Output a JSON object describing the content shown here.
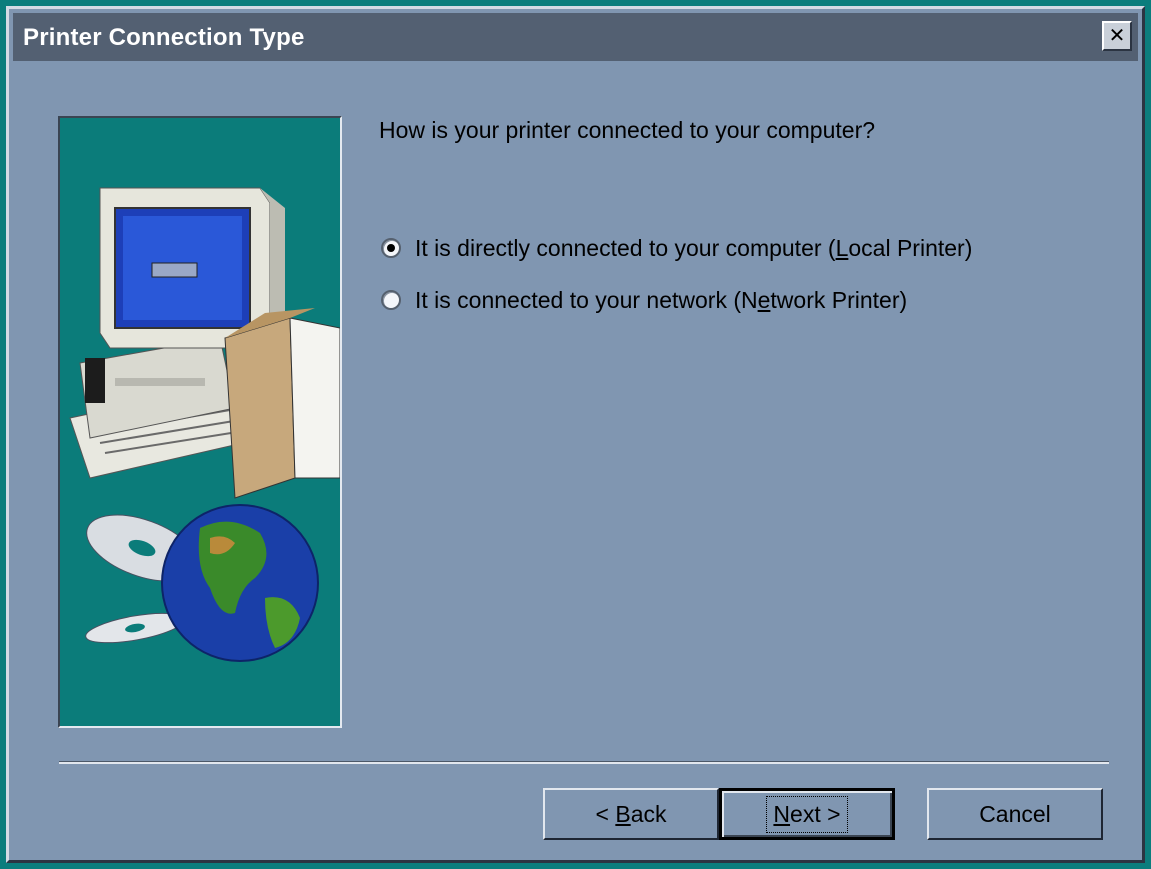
{
  "window": {
    "title": "Printer Connection Type",
    "close_label": "✕"
  },
  "question": "How is your printer connected to your computer?",
  "options": [
    {
      "pre": "It is directly connected to your computer (",
      "mnemonic": "L",
      "post": "ocal Printer)",
      "selected": true
    },
    {
      "pre": "It is connected to your network (N",
      "mnemonic": "e",
      "post": "twork Printer)",
      "selected": false
    }
  ],
  "buttons": {
    "back": {
      "pre": "< ",
      "mnemonic": "B",
      "post": "ack"
    },
    "next": {
      "pre": "",
      "mnemonic": "N",
      "post": "ext >"
    },
    "cancel": "Cancel"
  },
  "graphic": {
    "icons": [
      "computer-icon",
      "cd-disc-icon",
      "globe-icon"
    ]
  },
  "colors": {
    "desktop": "#0b7d7d",
    "dialog": "#8096b1",
    "titlebar": "#536072",
    "panel": "#0b7c7a"
  }
}
